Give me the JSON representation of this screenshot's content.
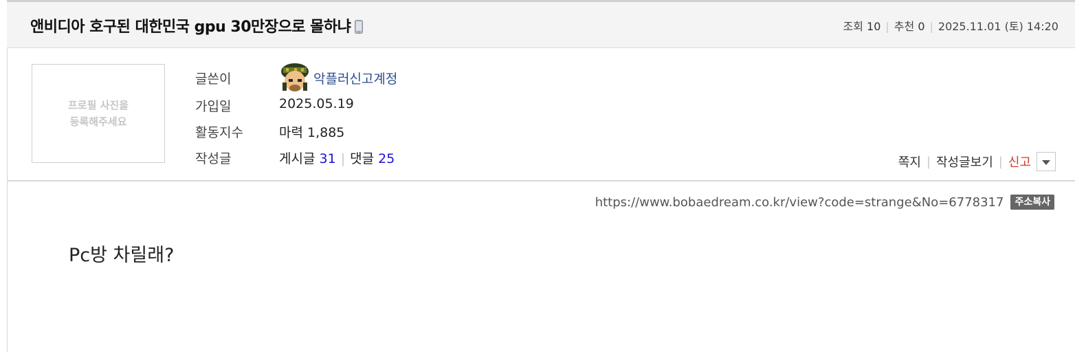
{
  "post": {
    "title": "앤비디아 호구된 대한민국 gpu 30만장으로 몰하냐",
    "mobile_icon": "mobile-phone-icon",
    "views_label": "조회",
    "views": "10",
    "recommend_label": "추천",
    "recommend": "0",
    "datetime": "2025.11.01 (토) 14:20"
  },
  "profile": {
    "photo_placeholder_line1": "프로필 사진을",
    "photo_placeholder_line2": "등록해주세요",
    "author_label": "글쓴이",
    "author": "악플러신고계정",
    "joined_label": "가입일",
    "joined": "2025.05.19",
    "activity_label": "활동지수",
    "activity": "마력 1,885",
    "posts_label": "작성글",
    "articles_label": "게시글",
    "articles": "31",
    "comments_label": "댓글",
    "comments": "25"
  },
  "actions": {
    "message": "쪽지",
    "view_posts": "작성글보기",
    "report": "신고"
  },
  "url": {
    "address": "https://www.bobaedream.co.kr/view?code=strange&No=6778317",
    "copy_label": "주소복사"
  },
  "content": {
    "text": "Pc방 차릴래?"
  },
  "colors": {
    "nickname": "#2d4e8f",
    "count": "#1d12d6",
    "report": "#d23a2b",
    "copy_button": "#666666"
  }
}
